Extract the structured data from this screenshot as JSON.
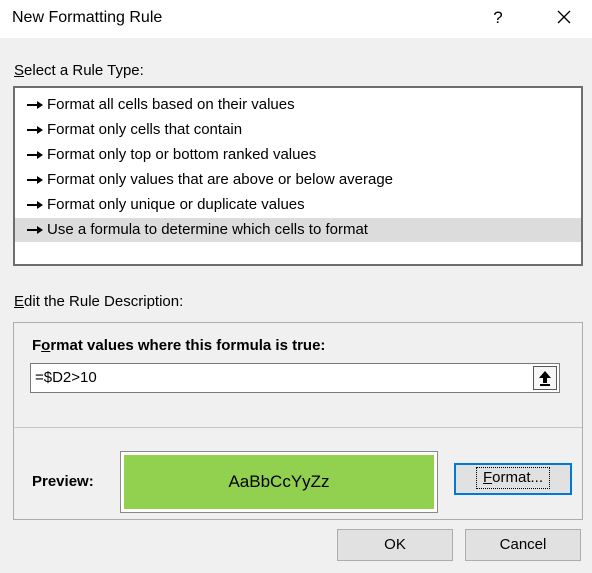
{
  "window": {
    "title": "New Formatting Rule",
    "help_label": "?"
  },
  "rule_type": {
    "label_key": "S",
    "label_rest": "elect a Rule Type:",
    "items": [
      {
        "label": "Format all cells based on their values",
        "selected": false
      },
      {
        "label": "Format only cells that contain",
        "selected": false
      },
      {
        "label": "Format only top or bottom ranked values",
        "selected": false
      },
      {
        "label": "Format only values that are above or below average",
        "selected": false
      },
      {
        "label": "Format only unique or duplicate values",
        "selected": false
      },
      {
        "label": "Use a formula to determine which cells to format",
        "selected": true
      }
    ]
  },
  "description": {
    "label_key": "E",
    "label_rest": "dit the Rule Description:",
    "formula_title_pre": "F",
    "formula_title_key": "o",
    "formula_title_post": "rmat values where this formula is true:",
    "formula_value": "=$D2>10",
    "preview_label": "Preview:",
    "preview_text": "AaBbCcYyZz",
    "preview_fill": "#92d050",
    "format_key": "F",
    "format_rest": "ormat..."
  },
  "buttons": {
    "ok": "OK",
    "cancel": "Cancel"
  }
}
